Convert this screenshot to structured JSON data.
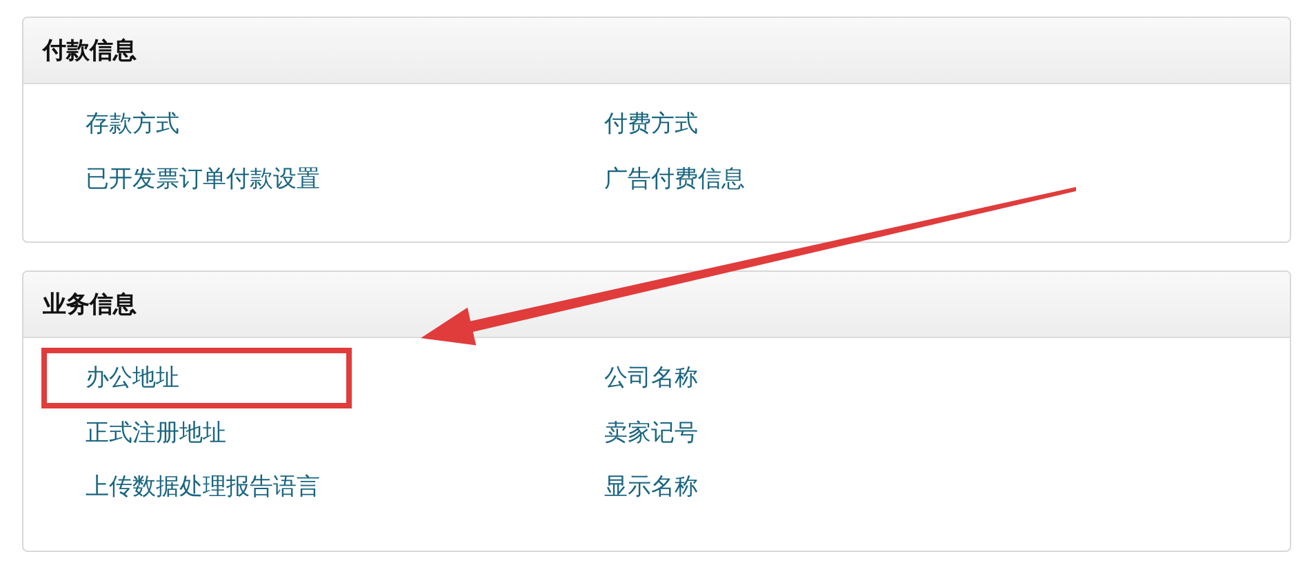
{
  "sections": [
    {
      "title": "付款信息",
      "links": [
        {
          "label": "存款方式",
          "highlighted": false
        },
        {
          "label": "付费方式",
          "highlighted": false
        },
        {
          "label": "已开发票订单付款设置",
          "highlighted": false
        },
        {
          "label": "广告付费信息",
          "highlighted": false
        }
      ]
    },
    {
      "title": "业务信息",
      "links": [
        {
          "label": "办公地址",
          "highlighted": true
        },
        {
          "label": "公司名称",
          "highlighted": false
        },
        {
          "label": "正式注册地址",
          "highlighted": false
        },
        {
          "label": "卖家记号",
          "highlighted": false
        },
        {
          "label": "上传数据处理报告语言",
          "highlighted": false
        },
        {
          "label": "显示名称",
          "highlighted": false
        }
      ]
    }
  ]
}
